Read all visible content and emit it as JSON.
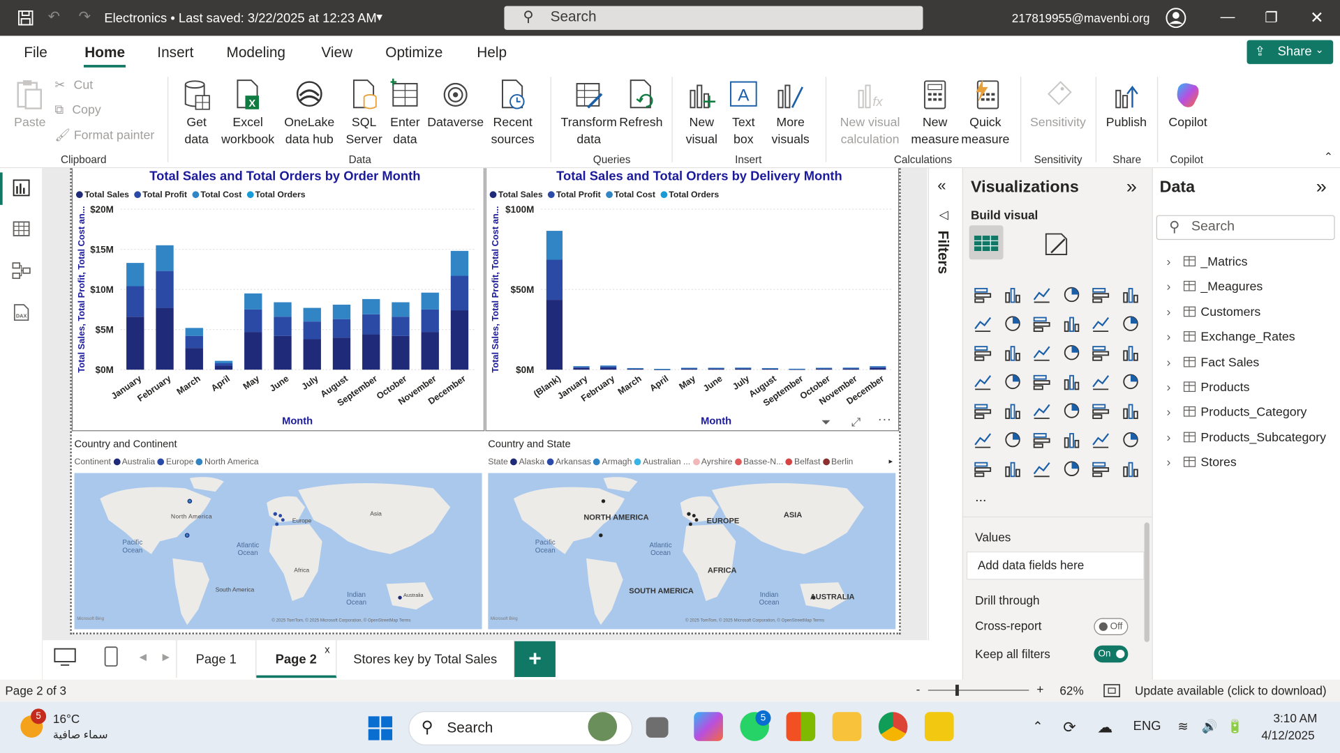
{
  "titlebar": {
    "title": "Electronics • Last saved: 3/22/2025 at 12:23 AM",
    "search_placeholder": "Search",
    "user": "217819955@mavenbi.org"
  },
  "menu": {
    "items": [
      "File",
      "Home",
      "Insert",
      "Modeling",
      "View",
      "Optimize",
      "Help"
    ],
    "active": "Home",
    "share_label": "Share"
  },
  "ribbon": {
    "clipboard": {
      "paste": "Paste",
      "cut": "Cut",
      "copy": "Copy",
      "format_painter": "Format painter",
      "group": "Clipboard"
    },
    "data": {
      "get_data": "Get data",
      "excel": "Excel workbook",
      "onelake": "OneLake data hub",
      "sql": "SQL Server",
      "enter": "Enter data",
      "dataverse": "Dataverse",
      "recent": "Recent sources",
      "group": "Data"
    },
    "queries": {
      "transform": "Transform data",
      "refresh": "Refresh",
      "group": "Queries"
    },
    "insert": {
      "new_visual": "New visual",
      "text_box": "Text box",
      "more_visuals": "More visuals",
      "group": "Insert"
    },
    "calculations": {
      "new_visual_calc": "New visual calculation",
      "new_measure": "New measure",
      "quick_measure": "Quick measure",
      "group": "Calculations"
    },
    "sensitivity": {
      "label": "Sensitivity",
      "group": "Sensitivity"
    },
    "share": {
      "publish": "Publish",
      "group": "Share"
    },
    "copilot": {
      "label": "Copilot",
      "group": "Copilot"
    }
  },
  "legend": {
    "items": [
      "Total Sales",
      "Total Profit",
      "Total Cost",
      "Total Orders"
    ],
    "colors": [
      "#1f2a78",
      "#2a4aa6",
      "#3185c4",
      "#1a9bd7"
    ]
  },
  "chart_data": [
    {
      "type": "bar",
      "stacked": true,
      "title": "Total Sales and Total Orders by Order Month",
      "xlabel": "Month",
      "ylabel": "Total Sales, Total Profit, Total Cost an...",
      "ylim": [
        0,
        20
      ],
      "yticks": [
        "$0M",
        "$5M",
        "$10M",
        "$15M",
        "$20M"
      ],
      "categories": [
        "January",
        "February",
        "March",
        "April",
        "May",
        "June",
        "July",
        "August",
        "September",
        "October",
        "November",
        "December"
      ],
      "series": [
        {
          "name": "Total Sales",
          "values": [
            6.6,
            7.7,
            2.7,
            0.5,
            4.7,
            4.2,
            3.8,
            4.0,
            4.4,
            4.2,
            4.7,
            7.4
          ]
        },
        {
          "name": "Total Profit",
          "values": [
            3.8,
            4.6,
            1.5,
            0.3,
            2.8,
            2.4,
            2.2,
            2.3,
            2.5,
            2.4,
            2.8,
            4.3
          ]
        },
        {
          "name": "Total Cost",
          "values": [
            2.9,
            3.2,
            1.0,
            0.3,
            2.0,
            1.8,
            1.7,
            1.8,
            1.9,
            1.8,
            2.1,
            3.1
          ]
        },
        {
          "name": "Total Orders",
          "values": [
            0,
            0,
            0,
            0,
            0,
            0,
            0,
            0,
            0,
            0,
            0,
            0
          ]
        }
      ]
    },
    {
      "type": "bar",
      "stacked": true,
      "title": "Total Sales and Total Orders by Delivery Month",
      "xlabel": "Month",
      "ylabel": "Total Sales, Total Profit, Total Cost an...",
      "ylim": [
        0,
        100
      ],
      "yticks": [
        "$0M",
        "$50M",
        "$100M"
      ],
      "categories": [
        "(Blank)",
        "January",
        "February",
        "March",
        "April",
        "May",
        "June",
        "July",
        "August",
        "September",
        "October",
        "November",
        "December"
      ],
      "series": [
        {
          "name": "Total Sales",
          "values": [
            43.5,
            1.0,
            1.2,
            0.5,
            0.2,
            0.5,
            0.5,
            0.6,
            0.5,
            0.3,
            0.5,
            0.6,
            1.0
          ]
        },
        {
          "name": "Total Profit",
          "values": [
            25.0,
            0.7,
            0.8,
            0.3,
            0.2,
            0.4,
            0.4,
            0.4,
            0.3,
            0.2,
            0.4,
            0.4,
            0.7
          ]
        },
        {
          "name": "Total Cost",
          "values": [
            18.0,
            0.5,
            0.6,
            0.2,
            0.1,
            0.3,
            0.3,
            0.3,
            0.2,
            0.1,
            0.3,
            0.3,
            0.5
          ]
        },
        {
          "name": "Total Orders",
          "values": [
            0,
            0,
            0,
            0,
            0,
            0,
            0,
            0,
            0,
            0,
            0,
            0,
            0
          ]
        }
      ]
    }
  ],
  "maps": {
    "left": {
      "title": "Country and Continent",
      "legend_label": "Continent",
      "legend": [
        "Australia",
        "Europe",
        "North America"
      ],
      "legend_colors": [
        "#1f2a78",
        "#2a4aa6",
        "#3185c4"
      ],
      "labels": [
        "North America",
        "Europe",
        "Asia",
        "Pacific Ocean",
        "Atlantic Ocean",
        "Africa",
        "South America",
        "Indian Ocean",
        "Australia"
      ],
      "copyright": "© 2025 TomTom, © 2025 Microsoft Corporation, © OpenStreetMap  Terms",
      "logo": "Microsoft Bing"
    },
    "right": {
      "title": "Country and State",
      "legend_label": "State",
      "legend": [
        "Alaska",
        "Arkansas",
        "Armagh",
        "Australian ...",
        "Ayrshire",
        "Basse-N...",
        "Belfast",
        "Berlin"
      ],
      "legend_colors": [
        "#1f2a78",
        "#2a4aa6",
        "#3185c4",
        "#35b5e8",
        "#f0b8b8",
        "#e05a5a",
        "#d64545",
        "#8b2f2f"
      ],
      "labels": [
        "NORTH AMERICA",
        "EUROPE",
        "ASIA",
        "Pacific Ocean",
        "Atlantic Ocean",
        "AFRICA",
        "SOUTH AMERICA",
        "Indian Ocean",
        "AUSTRALIA"
      ],
      "copyright": "© 2025 TomTom, © 2025 Microsoft Corporation, © OpenStreetMap  Terms",
      "logo": "Microsoft Bing"
    }
  },
  "filters": {
    "label": "Filters"
  },
  "visualizations": {
    "title": "Visualizations",
    "build_visual": "Build visual",
    "values": "Values",
    "add_fields": "Add data fields here",
    "drill_through": "Drill through",
    "cross_report": "Cross-report",
    "cross_report_state": "Off",
    "keep_filters": "Keep all filters",
    "keep_filters_state": "On",
    "more": "..."
  },
  "data_pane": {
    "title": "Data",
    "search_placeholder": "Search",
    "items": [
      "_Matrics",
      "_Meagures",
      "Customers",
      "Exchange_Rates",
      "Fact Sales",
      "Products",
      "Products_Category",
      "Products_Subcategory",
      "Stores"
    ]
  },
  "pages": {
    "tabs": [
      "Page 1",
      "Page 2",
      "Stores key by Total Sales"
    ],
    "active": "Page 2",
    "close": "x",
    "add": "+"
  },
  "status": {
    "page": "Page 2 of 3",
    "zoom": "62%",
    "update": "Update available (click to download)"
  },
  "taskbar": {
    "weather_temp": "16°C",
    "weather_desc": "سماء صافية",
    "weather_badge": "5",
    "search": "Search",
    "whatsapp_badge": "5",
    "lang": "ENG",
    "time": "3:10 AM",
    "date": "4/12/2025"
  }
}
